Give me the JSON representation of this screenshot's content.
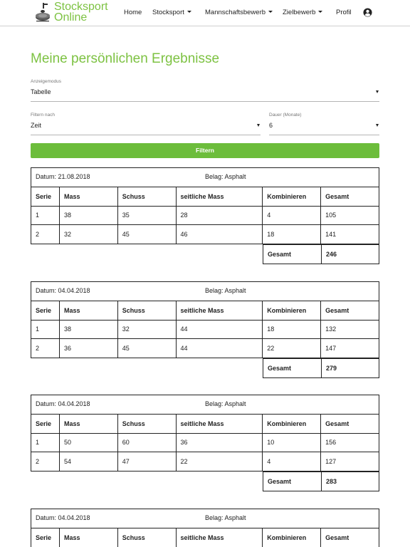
{
  "app": {
    "logo_line1": "Stocksport",
    "logo_line2": "Online"
  },
  "nav": {
    "home": "Home",
    "stocksport": "Stocksport",
    "mannschaft": "Mannschaftsbewerb",
    "ziel": "Zielbewerb",
    "profil": "Profil"
  },
  "page": {
    "title": "Meine persönlichen Ergebnisse"
  },
  "form": {
    "mode_label": "Anzeigemodus",
    "mode_value": "Tabelle",
    "filter_label": "Filtern nach",
    "filter_value": "Zeit",
    "duration_label": "Dauer (Monate)",
    "duration_value": "6",
    "submit": "Filtern"
  },
  "table_headers": [
    "Serie",
    "Mass",
    "Schuss",
    "seitliche Mass",
    "Kombinieren",
    "Gesamt"
  ],
  "total_label": "Gesamt",
  "results": [
    {
      "date": "Datum: 21.08.2018",
      "belag": "Belag: Asphalt",
      "rows": [
        [
          "1",
          "38",
          "35",
          "28",
          "4",
          "105"
        ],
        [
          "2",
          "32",
          "45",
          "46",
          "18",
          "141"
        ]
      ],
      "total": "246"
    },
    {
      "date": "Datum: 04.04.2018",
      "belag": "Belag: Asphalt",
      "rows": [
        [
          "1",
          "38",
          "32",
          "44",
          "18",
          "132"
        ],
        [
          "2",
          "36",
          "45",
          "44",
          "22",
          "147"
        ]
      ],
      "total": "279"
    },
    {
      "date": "Datum: 04.04.2018",
      "belag": "Belag: Asphalt",
      "rows": [
        [
          "1",
          "50",
          "60",
          "36",
          "10",
          "156"
        ],
        [
          "2",
          "54",
          "47",
          "22",
          "4",
          "127"
        ]
      ],
      "total": "283"
    },
    {
      "date": "Datum: 04.04.2018",
      "belag": "Belag: Asphalt",
      "rows": [],
      "total": ""
    }
  ],
  "colors": {
    "accent": "#7dc242",
    "button": "#6cbd3b",
    "border": "#222222"
  }
}
